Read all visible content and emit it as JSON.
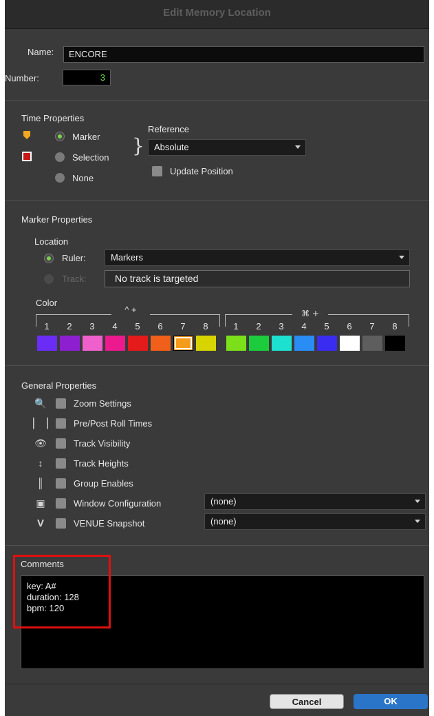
{
  "window": {
    "title": "Edit Memory Location"
  },
  "name_field": {
    "label": "Name:",
    "value": "ENCORE"
  },
  "number_field": {
    "label": "Number:",
    "value": "3"
  },
  "time_properties": {
    "title": "Time Properties",
    "radios": [
      "Marker",
      "Selection",
      "None"
    ],
    "selected": "Marker",
    "reference_label": "Reference",
    "reference_value": "Absolute",
    "update_position_label": "Update Position"
  },
  "marker_properties": {
    "title": "Marker Properties",
    "location_label": "Location",
    "ruler_label": "Ruler:",
    "ruler_value": "Markers",
    "track_label": "Track:",
    "track_value": "No track is targeted",
    "color_label": "Color",
    "group1_modifier": "^ +",
    "group2_modifier": "⌘ +",
    "numbers": [
      "1",
      "2",
      "3",
      "4",
      "5",
      "6",
      "7",
      "8"
    ],
    "colors_group1": [
      "#6b2cf5",
      "#8e1fd1",
      "#f060cc",
      "#ec1a8e",
      "#e51a1a",
      "#f0601a",
      "#f59c1a",
      "#d8d400"
    ],
    "colors_group2": [
      "#7be01a",
      "#1ccc3c",
      "#1ce0d0",
      "#2a8cf5",
      "#3a2cf0",
      "#ffffff",
      "#5e5e5e",
      "#000000"
    ],
    "selected_color_index": 6
  },
  "general_properties": {
    "title": "General Properties",
    "items": [
      {
        "icon": "magnifier-icon",
        "glyph": "🔍",
        "label": "Zoom Settings"
      },
      {
        "icon": "pre-post-roll-icon",
        "glyph": "▏▕",
        "label": "Pre/Post Roll Times"
      },
      {
        "icon": "eye-icon",
        "glyph": "👁",
        "label": "Track Visibility"
      },
      {
        "icon": "track-heights-icon",
        "glyph": "↕",
        "label": "Track Heights"
      },
      {
        "icon": "group-enables-icon",
        "glyph": "║",
        "label": "Group Enables"
      },
      {
        "icon": "window-config-icon",
        "glyph": "▣",
        "label": "Window Configuration"
      },
      {
        "icon": "venue-icon",
        "glyph": "V",
        "label": "VENUE Snapshot"
      }
    ],
    "window_config_value": "(none)",
    "venue_snapshot_value": "(none)"
  },
  "comments": {
    "title": "Comments",
    "lines": [
      "key: A#",
      "duration: 128",
      "bpm: 120"
    ]
  },
  "buttons": {
    "cancel": "Cancel",
    "ok": "OK"
  },
  "highlight_color": "#e01010",
  "accent_color": "#2a75c8"
}
